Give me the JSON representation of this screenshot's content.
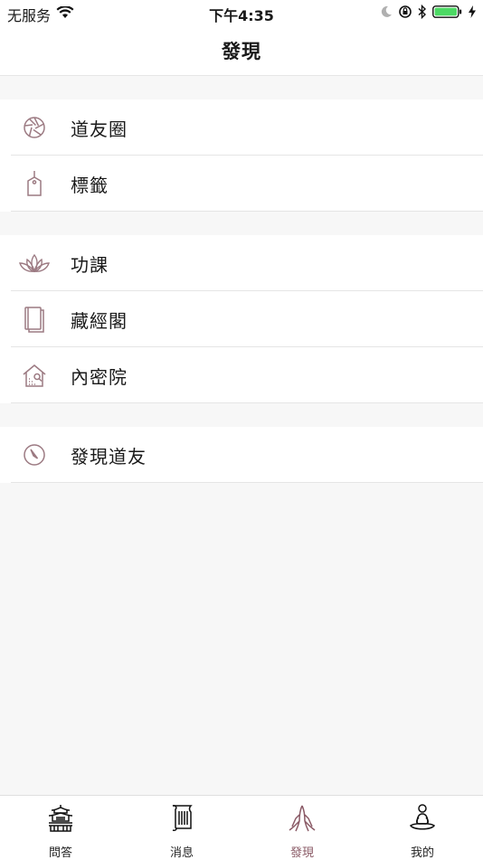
{
  "status_bar": {
    "carrier": "无服务",
    "time": "下午4:35"
  },
  "nav": {
    "title": "發現"
  },
  "groups": [
    {
      "items": [
        {
          "label": "道友圈",
          "icon": "aperture-icon"
        },
        {
          "label": "標籤",
          "icon": "tag-icon"
        }
      ]
    },
    {
      "items": [
        {
          "label": "功課",
          "icon": "lotus-icon"
        },
        {
          "label": "藏經閣",
          "icon": "book-icon"
        },
        {
          "label": "內密院",
          "icon": "temple-house-icon"
        }
      ]
    },
    {
      "items": [
        {
          "label": "發現道友",
          "icon": "compass-icon"
        }
      ]
    }
  ],
  "tabs": [
    {
      "label": "問答",
      "icon": "pagoda-icon"
    },
    {
      "label": "消息",
      "icon": "scroll-icon"
    },
    {
      "label": "發現",
      "icon": "praying-hands-icon",
      "active": true
    },
    {
      "label": "我的",
      "icon": "meditation-icon"
    }
  ],
  "colors": {
    "accent": "#8a5a66",
    "icon_tint": "#9c7a82",
    "battery": "#4cd964"
  }
}
